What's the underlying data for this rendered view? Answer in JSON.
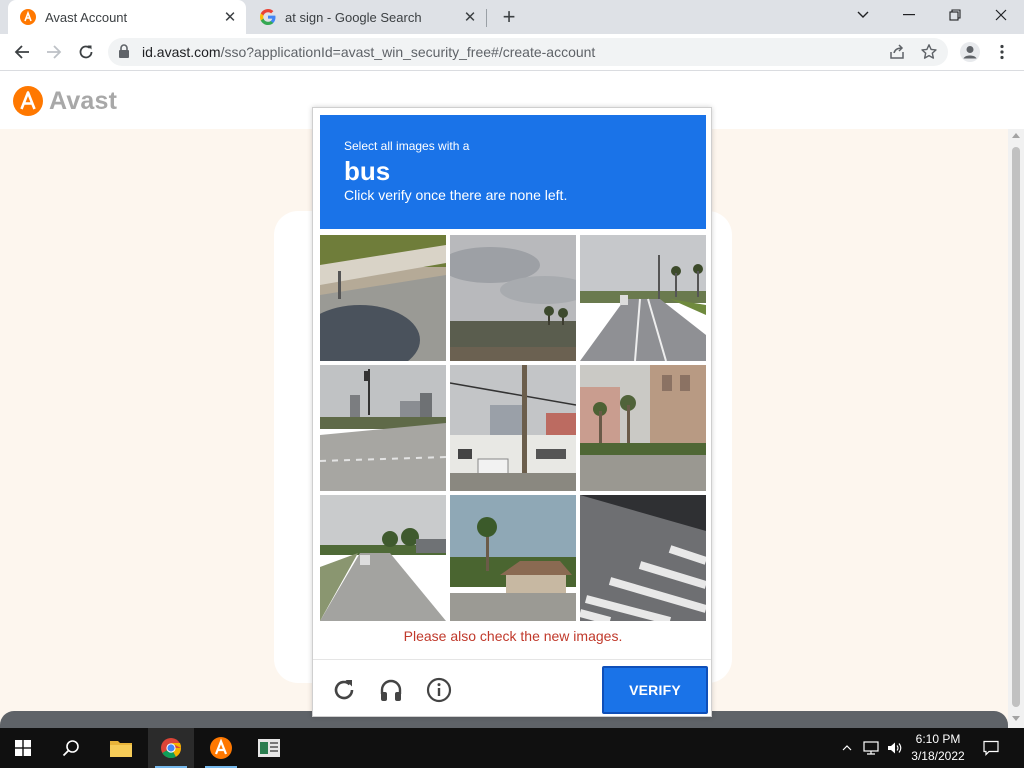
{
  "browser": {
    "tabs": [
      {
        "title": "Avast Account",
        "icon": "avast-logo-icon",
        "active": true
      },
      {
        "title": "at sign - Google Search",
        "icon": "google-g-icon",
        "active": false
      }
    ],
    "url": {
      "host": "id.avast.com",
      "path": "/sso?applicationId=avast_win_security_free#/create-account"
    }
  },
  "page": {
    "logo_text": "Avast",
    "brand_color": "#ff7800"
  },
  "captcha": {
    "instruction_pre": "Select all images with a",
    "target": "bus",
    "instruction_post": "Click verify once there are none left.",
    "error": "Please also check the new images.",
    "verify_label": "VERIFY",
    "tiles": [
      "guardrail and road shadow",
      "cloudy sky over trees",
      "highway with car and palm trees",
      "road with traffic light and buildings",
      "bus behind utility pole",
      "building with palm trees",
      "road with truck",
      "house with palm tree",
      "crosswalk stripes"
    ],
    "footer_icons": [
      "reload-icon",
      "audio-headphones-icon",
      "info-icon"
    ],
    "header_color": "#1a73e8",
    "error_color": "#c0392b"
  },
  "taskbar": {
    "time": "6:10 PM",
    "date": "3/18/2022",
    "apps": [
      "start-icon",
      "search-icon",
      "file-explorer-icon",
      "chrome-icon",
      "avast-icon",
      "app-icon"
    ]
  }
}
